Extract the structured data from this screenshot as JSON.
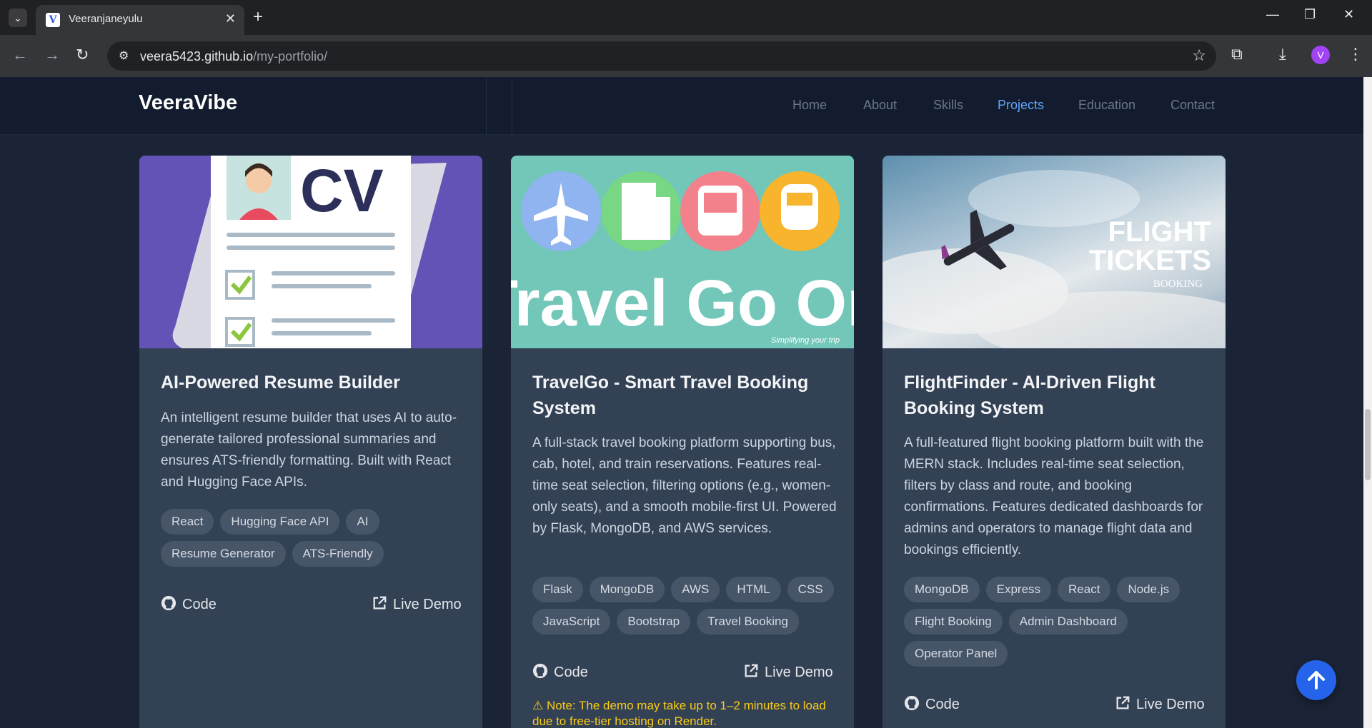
{
  "browser": {
    "tab_title": "Veeranjaneyulu",
    "favicon_letter": "V",
    "url_host": "veera5423.github.io",
    "url_path": "/my-portfolio/",
    "profile_initial": "V"
  },
  "site": {
    "brand": "VeeraVibe",
    "nav": [
      "Home",
      "About",
      "Skills",
      "Projects",
      "Education",
      "Contact"
    ],
    "active_nav": "Projects",
    "accent": "#60a5fa"
  },
  "projects": [
    {
      "title": "AI-Powered Resume Builder",
      "description": "An intelligent resume builder that uses AI to auto-generate tailored professional summaries and ensures ATS-friendly formatting. Built with React and Hugging Face APIs.",
      "tags": [
        "React",
        "Hugging Face API",
        "AI",
        "Resume Generator",
        "ATS-Friendly"
      ],
      "code_label": "Code",
      "demo_label": "Live Demo",
      "image_text": "CV"
    },
    {
      "title": "TravelGo - Smart Travel Booking System",
      "description": "A full-stack travel booking platform supporting bus, cab, hotel, and train reservations. Features real-time seat selection, filtering options (e.g., women-only seats), and a smooth mobile-first UI. Powered by Flask, MongoDB, and AWS services.",
      "tags": [
        "Flask",
        "MongoDB",
        "AWS",
        "HTML",
        "CSS",
        "JavaScript",
        "Bootstrap",
        "Travel Booking"
      ],
      "code_label": "Code",
      "demo_label": "Live Demo",
      "image_text": "Travel Go On",
      "image_subtext": "Simplifying your trip",
      "note": "Note: The demo may take up to 1–2 minutes to load due to free-tier hosting on Render."
    },
    {
      "title": "FlightFinder - AI-Driven Flight Booking System",
      "description": "A full-featured flight booking platform built with the MERN stack. Includes real-time seat selection, filters by class and route, and booking confirmations. Features dedicated dashboards for admins and operators to manage flight data and bookings efficiently.",
      "tags": [
        "MongoDB",
        "Express",
        "React",
        "Node.js",
        "Flight Booking",
        "Admin Dashboard",
        "Operator Panel"
      ],
      "code_label": "Code",
      "demo_label": "Live Demo",
      "image_text_1": "FLIGHT",
      "image_text_2": "TICKETS",
      "image_text_3": "BOOKING"
    }
  ]
}
